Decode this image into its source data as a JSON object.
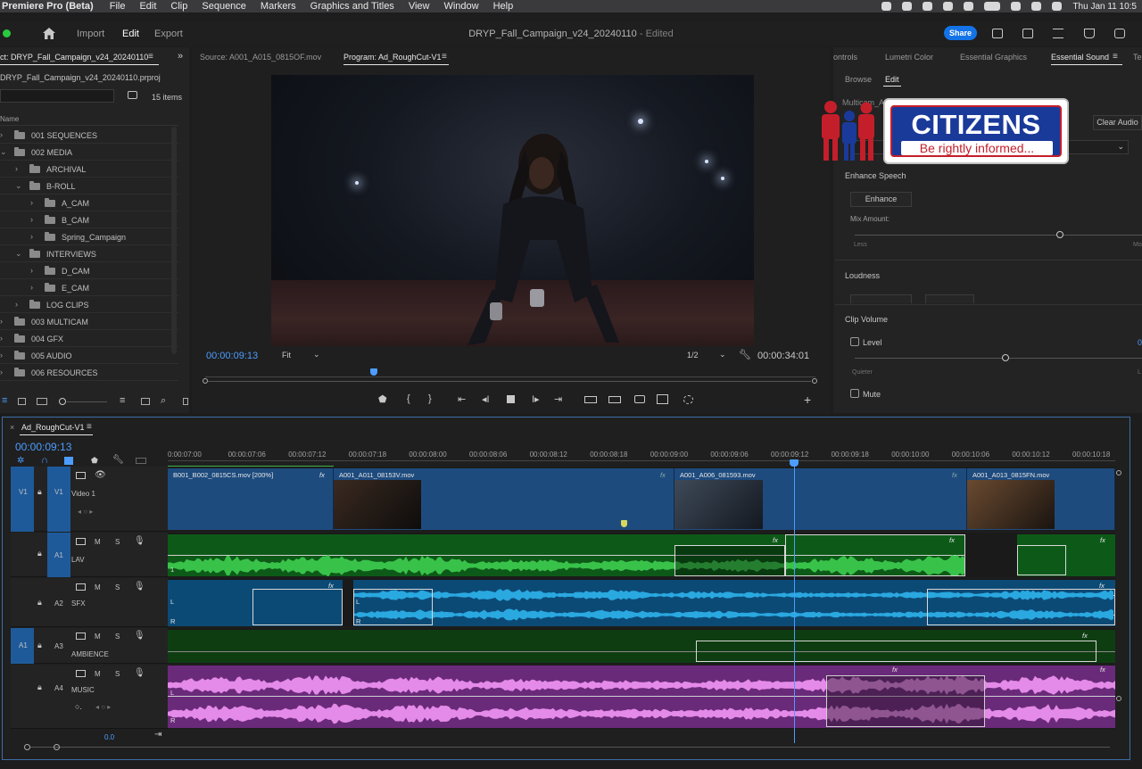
{
  "menubar": {
    "app": "Premiere Pro (Beta)",
    "items": [
      "File",
      "Edit",
      "Clip",
      "Sequence",
      "Markers",
      "Graphics and Titles",
      "View",
      "Window",
      "Help"
    ],
    "clock": "Thu Jan 11 10:5"
  },
  "header": {
    "tabs": [
      "Import",
      "Edit",
      "Export"
    ],
    "title": "DRYP_Fall_Campaign_v24_20240110",
    "status": "- Edited",
    "share": "Share"
  },
  "project": {
    "tab": "ct: DRYP_Fall_Campaign_v24_20240110",
    "file": "DRYP_Fall_Campaign_v24_20240110.prproj",
    "count": "15 items",
    "col_name": "Name",
    "rows": [
      {
        "label": "001 SEQUENCES",
        "indent": 0,
        "open": false
      },
      {
        "label": "002 MEDIA",
        "indent": 0,
        "open": true
      },
      {
        "label": "ARCHIVAL",
        "indent": 1,
        "open": false
      },
      {
        "label": "B-ROLL",
        "indent": 1,
        "open": true
      },
      {
        "label": "A_CAM",
        "indent": 2,
        "open": false
      },
      {
        "label": "B_CAM",
        "indent": 2,
        "open": false
      },
      {
        "label": "Spring_Campaign",
        "indent": 2,
        "open": false
      },
      {
        "label": "INTERVIEWS",
        "indent": 1,
        "open": true
      },
      {
        "label": "D_CAM",
        "indent": 2,
        "open": false
      },
      {
        "label": "E_CAM",
        "indent": 2,
        "open": false
      },
      {
        "label": "LOG CLIPS",
        "indent": 1,
        "open": false
      },
      {
        "label": "003 MULTICAM",
        "indent": 0,
        "open": false
      },
      {
        "label": "004 GFX",
        "indent": 0,
        "open": false
      },
      {
        "label": "005 AUDIO",
        "indent": 0,
        "open": false
      },
      {
        "label": "006 RESOURCES",
        "indent": 0,
        "open": false
      }
    ]
  },
  "monitor": {
    "source_tab": "Source: A001_A015_0815OF.mov",
    "program_tab": "Program: Ad_RoughCut-V1",
    "timecode": "00:00:09:13",
    "fit": "Fit",
    "resolution": "1/2",
    "duration": "00:00:34:01"
  },
  "essential_sound": {
    "tabs": [
      "ontrols",
      "Lumetri Color",
      "Essential Graphics",
      "Essential Sound",
      "Te"
    ],
    "subtabs": [
      "Browse",
      "Edit"
    ],
    "preset_label": "Multicam_Athl",
    "clear_audio": "Clear Audio",
    "enhance_speech": "Enhance Speech",
    "enhance_btn": "Enhance",
    "mix_amount": "Mix Amount:",
    "less": "Less",
    "more": "Mo",
    "loudness": "Loudness",
    "clip_volume": "Clip Volume",
    "level": "Level",
    "level_value": "0",
    "quieter": "Quieter",
    "louder": "L",
    "mute": "Mute"
  },
  "logo": {
    "title": "CITIZENS",
    "tagline": "Be rightly informed..."
  },
  "timeline": {
    "tab": "Ad_RoughCut-V1",
    "timecode": "00:00:09:13",
    "ruler": [
      "0:00:07:00",
      "00:00:07:06",
      "00:00:07:12",
      "00:00:07:18",
      "00:00:08:00",
      "00:00:08:06",
      "00:00:08:12",
      "00:00:08:18",
      "00:00:09:00",
      "00:00:09:06",
      "00:00:09:12",
      "00:00:09:18",
      "00:00:10:00",
      "00:00:10:06",
      "00:00:10:12",
      "00:00:10:18"
    ],
    "tracks": {
      "v1": "V1",
      "video1": "Video 1",
      "a1": "A1",
      "lav": "LAV",
      "a2": "A2",
      "sfx": "SFX",
      "a3": "A3",
      "ambience": "AMBIENCE",
      "a4": "A4",
      "music": "MUSIC",
      "m": "M",
      "s": "S"
    },
    "clips": {
      "c1": "B001_B002_0815CS.mov [200%]",
      "c2": "A001_A011_08153V.mov",
      "c3": "A001_A006_081593.mov",
      "c4": "A001_A013_0815FN.mov"
    },
    "fx": "fx",
    "music_level": "0.0",
    "ch_l": "L",
    "ch_r": "R",
    "ch_1": "1"
  }
}
